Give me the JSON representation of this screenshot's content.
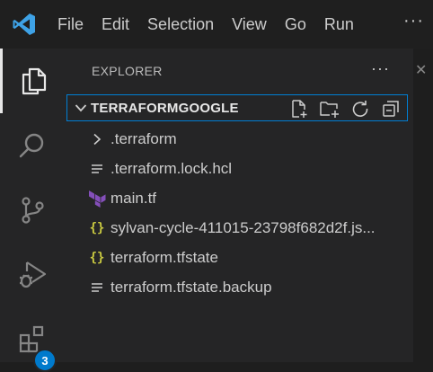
{
  "menu": {
    "items": [
      "File",
      "Edit",
      "Selection",
      "View",
      "Go",
      "Run"
    ],
    "more": "···"
  },
  "activity_bar": {
    "extensions_badge": "3"
  },
  "explorer": {
    "title": "EXPLORER",
    "more": "···",
    "folder": "TERRAFORMGOOGLE",
    "files": [
      {
        "name": ".terraform",
        "icon": "chevron-right-icon"
      },
      {
        "name": ".terraform.lock.hcl",
        "icon": "file-lines-icon"
      },
      {
        "name": "main.tf",
        "icon": "terraform-icon"
      },
      {
        "name": "sylvan-cycle-411015-23798f682d2f.js...",
        "icon": "json-braces-icon"
      },
      {
        "name": "terraform.tfstate",
        "icon": "json-braces-icon"
      },
      {
        "name": "terraform.tfstate.backup",
        "icon": "file-lines-icon"
      }
    ]
  },
  "colors": {
    "accent": "#007acc",
    "focus_border": "#007fd4",
    "terraform": "#844fba",
    "json": "#cbcb41"
  }
}
